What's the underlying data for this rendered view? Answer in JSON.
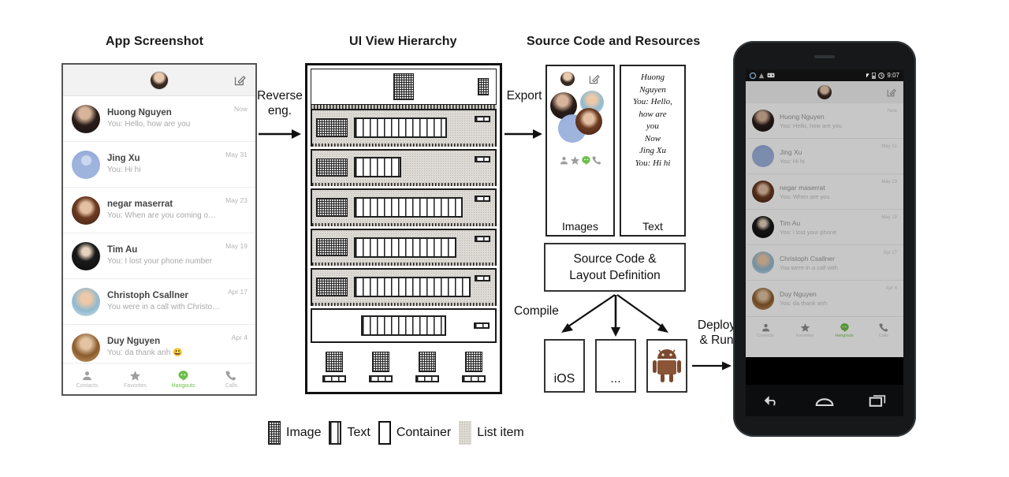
{
  "titles": {
    "app_screenshot": "App Screenshot",
    "ui_view_hierarchy": "UI View Hierarchy",
    "source_code_resources": "Source Code and Resources"
  },
  "flow": {
    "reverse_eng": "Reverse\neng.",
    "export": "Export",
    "compile": "Compile",
    "deploy_run": "Deploy\n& Run"
  },
  "app": {
    "rows": [
      {
        "name": "Huong Nguyen",
        "message": "You: Hello, how are you",
        "time": "Now"
      },
      {
        "name": "Jing Xu",
        "message": "You: Hi hi",
        "time": "May 31"
      },
      {
        "name": "negar maserrat",
        "message": "You: When are you coming over",
        "time": "May 23"
      },
      {
        "name": "Tim Au",
        "message": "You: I lost your phone number",
        "time": "May 19"
      },
      {
        "name": "Christoph Csallner",
        "message": "You were in a call with Christoph",
        "time": "Apr 17"
      },
      {
        "name": "Duy Nguyen",
        "message": "You: da thank anh 😃",
        "time": "Apr 4"
      }
    ],
    "tabs": [
      {
        "label": "Contacts",
        "icon": "person-icon",
        "active": false
      },
      {
        "label": "Favorites",
        "icon": "star-icon",
        "active": false
      },
      {
        "label": "Hangouts",
        "icon": "hangouts-icon",
        "active": true
      },
      {
        "label": "Calls",
        "icon": "phone-icon",
        "active": false
      }
    ],
    "appbar": {
      "avatar": "avatar-icon",
      "compose": "compose-icon"
    }
  },
  "resources": {
    "images_caption": "Images",
    "text_caption": "Text",
    "text_items": [
      "Huong",
      "Nguyen",
      "You: Hello,",
      "how are",
      "you",
      "Now",
      "Jing Xu",
      "You: Hi hi"
    ]
  },
  "source_box": {
    "line1": "Source Code &",
    "line2": "Layout Definition"
  },
  "platforms": [
    {
      "label": "iOS",
      "name": "ios-target"
    },
    {
      "label": "...",
      "name": "other-target"
    },
    {
      "label": "",
      "name": "android-target"
    }
  ],
  "device": {
    "clock": "9:07",
    "rows": [
      {
        "name": "Huong Nguyen",
        "message": "You: Hello, how are you",
        "time": "Now"
      },
      {
        "name": "Jing Xu",
        "message": "You: Hi hi",
        "time": "May 31"
      },
      {
        "name": "negar maserrat",
        "message": "You: When are you",
        "time": "May 23"
      },
      {
        "name": "Tim Au",
        "message": "You: I lost your phone",
        "time": "May 19"
      },
      {
        "name": "Christoph Csallner",
        "message": "You were in a call with",
        "time": "Apr 17"
      },
      {
        "name": "Duy Nguyen",
        "message": "You: da thank anh",
        "time": "Apr 4"
      }
    ],
    "tabs": [
      {
        "label": "Contacts",
        "active": false
      },
      {
        "label": "Favorites",
        "active": false
      },
      {
        "label": "Hangouts",
        "active": true
      },
      {
        "label": "Calls",
        "active": false
      }
    ],
    "nav": [
      "back-icon",
      "home-icon",
      "recents-icon"
    ]
  },
  "legend": [
    {
      "label": "Image",
      "swatch": "image-swatch"
    },
    {
      "label": "Text",
      "swatch": "text-swatch"
    },
    {
      "label": "Container",
      "swatch": "container-swatch"
    },
    {
      "label": "List item",
      "swatch": "listitem-swatch"
    }
  ],
  "colors": {
    "accent_green": "#6dbf4b",
    "outline": "#1a1a1a",
    "list_item_fill": "#dedbd6",
    "image_fill": "#2b2b2b",
    "device_body": "#16181a"
  }
}
